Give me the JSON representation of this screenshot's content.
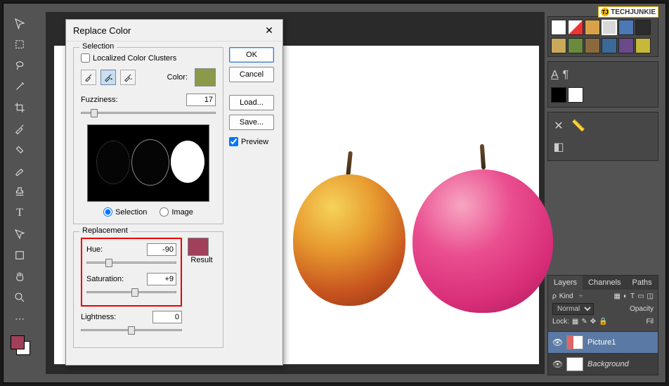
{
  "watermark": "TECHJUNKIE",
  "dialog": {
    "title": "Replace Color",
    "selection_group": "Selection",
    "localized_label": "Localized Color Clusters",
    "color_label": "Color:",
    "selection_color": "#8a9a4a",
    "fuzziness_label": "Fuzziness:",
    "fuzziness_value": "17",
    "radio_selection": "Selection",
    "radio_image": "Image",
    "replacement_group": "Replacement",
    "hue_label": "Hue:",
    "hue_value": "-90",
    "sat_label": "Saturation:",
    "sat_value": "+9",
    "light_label": "Lightness:",
    "light_value": "0",
    "result_label": "Result",
    "result_color": "#a0405a",
    "ok": "OK",
    "cancel": "Cancel",
    "load": "Load...",
    "save": "Save...",
    "preview_label": "Preview"
  },
  "layers": {
    "tab_layers": "Layers",
    "tab_channels": "Channels",
    "tab_paths": "Paths",
    "kind_label": "Kind",
    "blend_mode": "Normal",
    "opacity_label": "Opacity",
    "lock_label": "Lock:",
    "fill_label": "Fil",
    "layer1": "Picture1",
    "layer2": "Background"
  },
  "swatches": {
    "row1": [
      "#ffffff",
      "#e83828",
      "#f5a939",
      "#d8d8d8",
      "#4c79b4",
      "#2c2c2c"
    ],
    "row1b": [
      "#c9a95a",
      "#6a8a3d",
      "#7a543c",
      "#3b6a98",
      "#6a4a8a",
      "#c5b83a"
    ],
    "row2": [
      "#000",
      "#fff"
    ]
  }
}
